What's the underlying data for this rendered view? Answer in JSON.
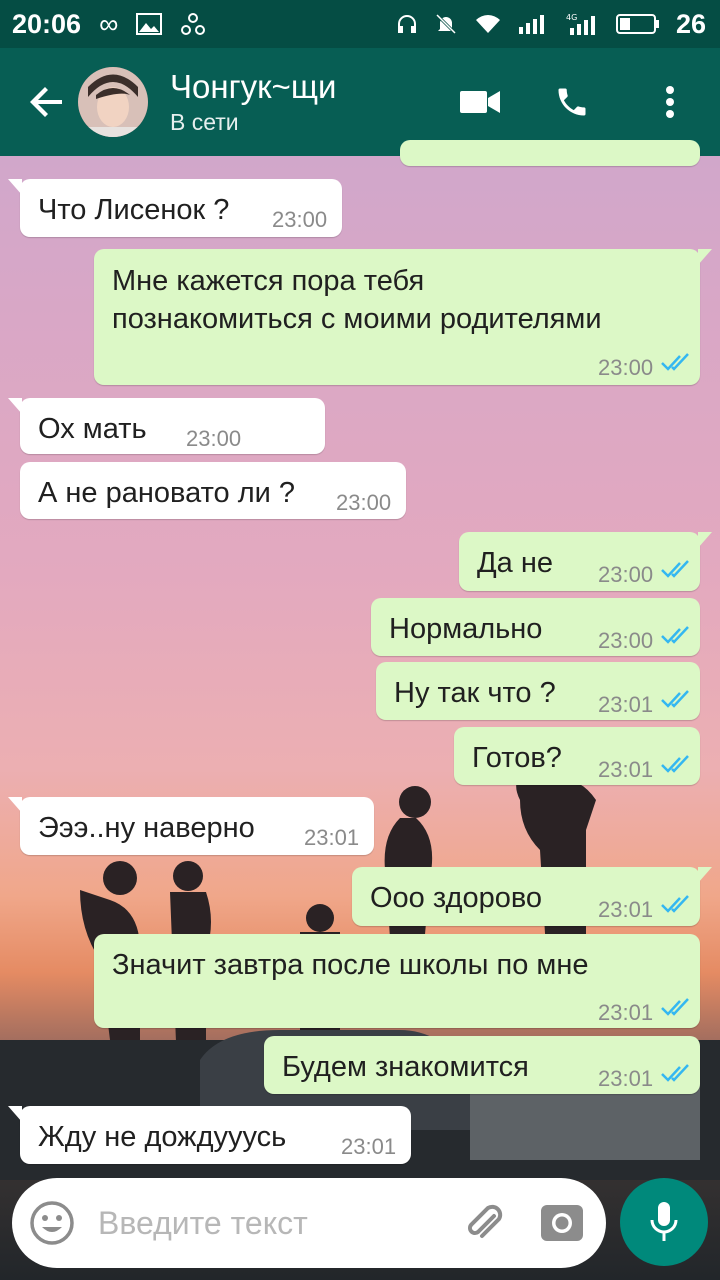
{
  "status_bar": {
    "time": "20:06",
    "battery": "26"
  },
  "header": {
    "name": "Чонгук~щи",
    "status": "В сети"
  },
  "messages": [
    {
      "dir": "in",
      "text": "Что Лисенок ?",
      "time": "23:00"
    },
    {
      "dir": "out",
      "text": "Мне кажется пора тебя\nпознакомиться с моими родителями",
      "time": "23:00"
    },
    {
      "dir": "in",
      "text": "Ох мать",
      "time": "23:00"
    },
    {
      "dir": "in",
      "text": "А не рановато ли ?",
      "time": "23:00"
    },
    {
      "dir": "out",
      "text": "Да не",
      "time": "23:00"
    },
    {
      "dir": "out",
      "text": "Нормально",
      "time": "23:00"
    },
    {
      "dir": "out",
      "text": "Ну так что ?",
      "time": "23:01"
    },
    {
      "dir": "out",
      "text": "Готов?",
      "time": "23:01"
    },
    {
      "dir": "in",
      "text": "Эээ..ну наверно",
      "time": "23:01"
    },
    {
      "dir": "out",
      "text": "Ооо здорово",
      "time": "23:01"
    },
    {
      "dir": "out",
      "text": "Значит завтра после школы по мне",
      "time": "23:01"
    },
    {
      "dir": "out",
      "text": "Будем знакомится",
      "time": "23:01"
    },
    {
      "dir": "in",
      "text": "Жду не дождууусь",
      "time": "23:01"
    }
  ],
  "input": {
    "placeholder": "Введите текст"
  },
  "colors": {
    "header": "#075e54",
    "statusbar": "#054d44",
    "incoming": "#ffffff",
    "outgoing": "#dcf8c6",
    "tick_read": "#34b7f1",
    "mic": "#00897b"
  },
  "icons": [
    "back-arrow-icon",
    "video-call-icon",
    "phone-icon",
    "more-vert-icon",
    "emoji-icon",
    "attach-icon",
    "camera-icon",
    "mic-icon"
  ]
}
